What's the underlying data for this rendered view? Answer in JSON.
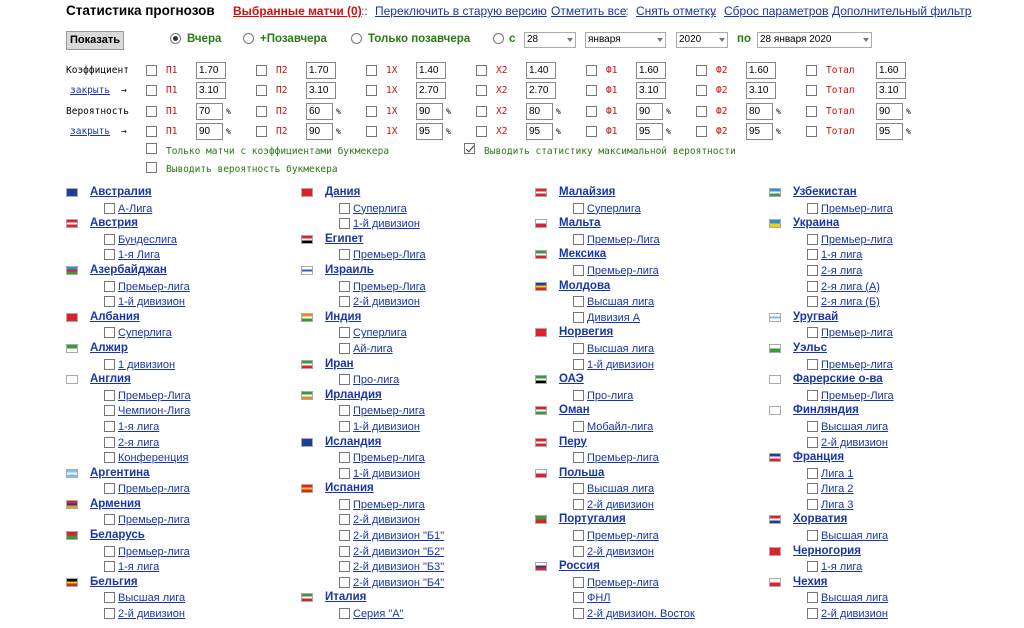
{
  "header": {
    "title": "Статистика прогнозов",
    "selected_matches": "Выбранные матчи (0)",
    "sep1": "::",
    "switch_old": "Переключить в старую версию",
    "mark_all": "Отметить все",
    "sep2": "::",
    "unmark": "Снять отметку",
    "sep3": "::",
    "reset": "Сброс параметров",
    "sep4": "::",
    "extra_filter": "Дополнительный фильтр"
  },
  "controls": {
    "show_button": "Показать",
    "radio_yesterday": "Вчера",
    "radio_plus_day_before": "+Позавчера",
    "radio_only_day_before": "Только позавчера",
    "radio_from": "с",
    "day_from": "28",
    "month_from": "января",
    "year_from": "2020",
    "to_label": "по",
    "date_to": "28 января 2020"
  },
  "filters": {
    "coef_label": "Коэффициент",
    "prob_label": "Вероятность",
    "close_link": "закрыть",
    "arrow": "→",
    "rows": [
      {
        "op": ">",
        "cells": [
          {
            "n": "П1",
            "v": "1.70"
          },
          {
            "n": "П2",
            "v": "1.70"
          },
          {
            "n": "1Х",
            "v": "1.40"
          },
          {
            "n": "Х2",
            "v": "1.40"
          },
          {
            "n": "Ф1",
            "v": "1.60"
          },
          {
            "n": "Ф2",
            "v": "1.60"
          },
          {
            "n": "Тотал",
            "v": "1.60"
          }
        ]
      },
      {
        "op": "<",
        "cells": [
          {
            "n": "П1",
            "v": "3.10"
          },
          {
            "n": "П2",
            "v": "3.10"
          },
          {
            "n": "1Х",
            "v": "2.70"
          },
          {
            "n": "Х2",
            "v": "2.70"
          },
          {
            "n": "Ф1",
            "v": "3.10"
          },
          {
            "n": "Ф2",
            "v": "3.10"
          },
          {
            "n": "Тотал",
            "v": "3.10"
          }
        ]
      },
      {
        "op": ">",
        "cells": [
          {
            "n": "П1",
            "v": "70"
          },
          {
            "n": "П2",
            "v": "60"
          },
          {
            "n": "1Х",
            "v": "90"
          },
          {
            "n": "Х2",
            "v": "80"
          },
          {
            "n": "Ф1",
            "v": "90"
          },
          {
            "n": "Ф2",
            "v": "80"
          },
          {
            "n": "Тотал",
            "v": "90"
          }
        ]
      },
      {
        "op": "<",
        "cells": [
          {
            "n": "П1",
            "v": "90"
          },
          {
            "n": "П2",
            "v": "90"
          },
          {
            "n": "1Х",
            "v": "95"
          },
          {
            "n": "Х2",
            "v": "95"
          },
          {
            "n": "Ф1",
            "v": "95"
          },
          {
            "n": "Ф2",
            "v": "95"
          },
          {
            "n": "Тотал",
            "v": "95"
          }
        ]
      }
    ],
    "pct": "%",
    "opt_only_bookmaker": "Только матчи с коэффициентами букмекера",
    "opt_max_prob": "Выводить статистику максимальной вероятности",
    "opt_bookmaker_prob": "Выводить вероятность букмекера"
  },
  "columns": [
    [
      {
        "country": "Австралия",
        "flag": [
          "#1c3f95",
          "#1c3f95"
        ],
        "leagues": [
          "А-Лига"
        ]
      },
      {
        "country": "Австрия",
        "flag": [
          "#e0202a",
          "#ffffff",
          "#e0202a"
        ],
        "leagues": [
          "Бундеслига",
          "1-я Лига"
        ]
      },
      {
        "country": "Азербайджан",
        "flag": [
          "#2c8fd6",
          "#e0202a",
          "#3a9a3a"
        ],
        "leagues": [
          "Премьер-лига",
          "1-й дивизион"
        ]
      },
      {
        "country": "Албания",
        "flag": [
          "#e0202a"
        ],
        "leagues": [
          "Суперлига"
        ]
      },
      {
        "country": "Алжир",
        "flag": [
          "#3a9a3a",
          "#ffffff"
        ],
        "leagues": [
          "1 дивизион"
        ]
      },
      {
        "country": "Англия",
        "flag": [
          "#ffffff"
        ],
        "leagues": [
          "Премьер-Лига",
          "Чемпион-Лига",
          "1-я лига",
          "2-я лига",
          "Конференция"
        ]
      },
      {
        "country": "Аргентина",
        "flag": [
          "#7cc1ea",
          "#ffffff",
          "#7cc1ea"
        ],
        "leagues": [
          "Премьер-лига"
        ]
      },
      {
        "country": "Армения",
        "flag": [
          "#e0202a",
          "#1c3f95",
          "#f0a020"
        ],
        "leagues": [
          "Премьер-лига"
        ]
      },
      {
        "country": "Беларусь",
        "flag": [
          "#e0202a",
          "#3a9a3a"
        ],
        "leagues": [
          "Премьер-лига",
          "1-я лига"
        ]
      },
      {
        "country": "Бельгия",
        "flag": [
          "#000000",
          "#f5d000",
          "#e0202a"
        ],
        "leagues": [
          "Высшая лига",
          "2-й дивизион"
        ]
      }
    ],
    [
      {
        "country": "Дания",
        "flag": [
          "#e0202a"
        ],
        "leagues": [
          "Суперлига",
          "1-й дивизион"
        ]
      },
      {
        "country": "Египет",
        "flag": [
          "#e0202a",
          "#ffffff",
          "#000000"
        ],
        "leagues": [
          "Премьер-Лига"
        ]
      },
      {
        "country": "Израиль",
        "flag": [
          "#ffffff",
          "#2c5fd6",
          "#ffffff"
        ],
        "leagues": [
          "Премьер-Лига",
          "2-й дивизион"
        ]
      },
      {
        "country": "Индия",
        "flag": [
          "#f08a20",
          "#ffffff",
          "#3a9a3a"
        ],
        "leagues": [
          "Суперлига",
          "Ай-лига"
        ]
      },
      {
        "country": "Иран",
        "flag": [
          "#3a9a3a",
          "#ffffff",
          "#e0202a"
        ],
        "leagues": [
          "Про-лига"
        ]
      },
      {
        "country": "Ирландия",
        "flag": [
          "#3a9a3a",
          "#ffffff",
          "#f08a20"
        ],
        "leagues": [
          "Премьер-лига",
          "1-й дивизион"
        ]
      },
      {
        "country": "Исландия",
        "flag": [
          "#1c3f95"
        ],
        "leagues": [
          "Премьер-лига",
          "1-й дивизион"
        ]
      },
      {
        "country": "Испания",
        "flag": [
          "#e0202a",
          "#f5d000",
          "#e0202a"
        ],
        "leagues": [
          "Премьер-лига",
          "2-й дивизион",
          "2-й дивизион \"Б1\"",
          "2-й дивизион \"Б2\"",
          "2-й дивизион \"Б3\"",
          "2-й дивизион \"Б4\""
        ]
      },
      {
        "country": "Италия",
        "flag": [
          "#3a9a3a",
          "#ffffff",
          "#e0202a"
        ],
        "leagues": [
          "Серия \"А\""
        ]
      }
    ],
    [
      {
        "country": "Малайзия",
        "flag": [
          "#e0202a",
          "#ffffff",
          "#e0202a"
        ],
        "leagues": [
          "Суперлига"
        ]
      },
      {
        "country": "Мальта",
        "flag": [
          "#ffffff",
          "#e0202a"
        ],
        "leagues": [
          "Премьер-Лига"
        ]
      },
      {
        "country": "Мексика",
        "flag": [
          "#3a9a3a",
          "#ffffff",
          "#e0202a"
        ],
        "leagues": [
          "Премьер-лига"
        ]
      },
      {
        "country": "Молдова",
        "flag": [
          "#1c3f95",
          "#f5d000",
          "#e0202a"
        ],
        "leagues": [
          "Высшая лига",
          "Дивизия А"
        ]
      },
      {
        "country": "Норвегия",
        "flag": [
          "#e0202a"
        ],
        "leagues": [
          "Высшая лига",
          "1-й дивизион"
        ]
      },
      {
        "country": "ОАЭ",
        "flag": [
          "#3a9a3a",
          "#ffffff",
          "#000000"
        ],
        "leagues": [
          "Про-лига"
        ]
      },
      {
        "country": "Оман",
        "flag": [
          "#e0202a",
          "#ffffff",
          "#3a9a3a"
        ],
        "leagues": [
          "Мобайл-лига"
        ]
      },
      {
        "country": "Перу",
        "flag": [
          "#e0202a",
          "#ffffff",
          "#e0202a"
        ],
        "leagues": [
          "Премьер-лига"
        ]
      },
      {
        "country": "Польша",
        "flag": [
          "#ffffff",
          "#e0202a"
        ],
        "leagues": [
          "Высшая лига",
          "2-й дивизион"
        ]
      },
      {
        "country": "Португалия",
        "flag": [
          "#3a9a3a",
          "#e0202a"
        ],
        "leagues": [
          "Премьер-лига",
          "2-й дивизион"
        ]
      },
      {
        "country": "Россия",
        "flag": [
          "#ffffff",
          "#1c3f95",
          "#e0202a"
        ],
        "leagues": [
          "Премьер-лига",
          "ФНЛ",
          "2-й дивизион. Восток"
        ]
      }
    ],
    [
      {
        "country": "Узбекистан",
        "flag": [
          "#2c8fd6",
          "#ffffff",
          "#3a9a3a"
        ],
        "leagues": [
          "Премьер-лига"
        ]
      },
      {
        "country": "Украина",
        "flag": [
          "#2c8fd6",
          "#f5d000"
        ],
        "leagues": [
          "Премьер-лига",
          "1-я лига",
          "2-я лига",
          "2-я лига (А)",
          "2-я лига (Б)"
        ]
      },
      {
        "country": "Уругвай",
        "flag": [
          "#ffffff",
          "#7cc1ea",
          "#ffffff"
        ],
        "leagues": [
          "Премьер-лига"
        ]
      },
      {
        "country": "Уэльс",
        "flag": [
          "#ffffff",
          "#3a9a3a"
        ],
        "leagues": [
          "Премьер-лига"
        ]
      },
      {
        "country": "Фарерские о-ва",
        "flag": [
          "#ffffff"
        ],
        "leagues": [
          "Премьер-Лига"
        ]
      },
      {
        "country": "Финляндия",
        "flag": [
          "#ffffff"
        ],
        "leagues": [
          "Высшая лига",
          "2-й дивизион"
        ]
      },
      {
        "country": "Франция",
        "flag": [
          "#1c3f95",
          "#ffffff",
          "#e0202a"
        ],
        "leagues": [
          "Лига 1",
          "Лига 2",
          "Лига 3"
        ]
      },
      {
        "country": "Хорватия",
        "flag": [
          "#e0202a",
          "#ffffff",
          "#1c3f95"
        ],
        "leagues": [
          "Высшая лига"
        ]
      },
      {
        "country": "Черногория",
        "flag": [
          "#e0202a"
        ],
        "leagues": [
          "1-я лига"
        ]
      },
      {
        "country": "Чехия",
        "flag": [
          "#ffffff",
          "#e0202a"
        ],
        "leagues": [
          "Высшая лига",
          "2-й дивизион"
        ]
      }
    ]
  ]
}
